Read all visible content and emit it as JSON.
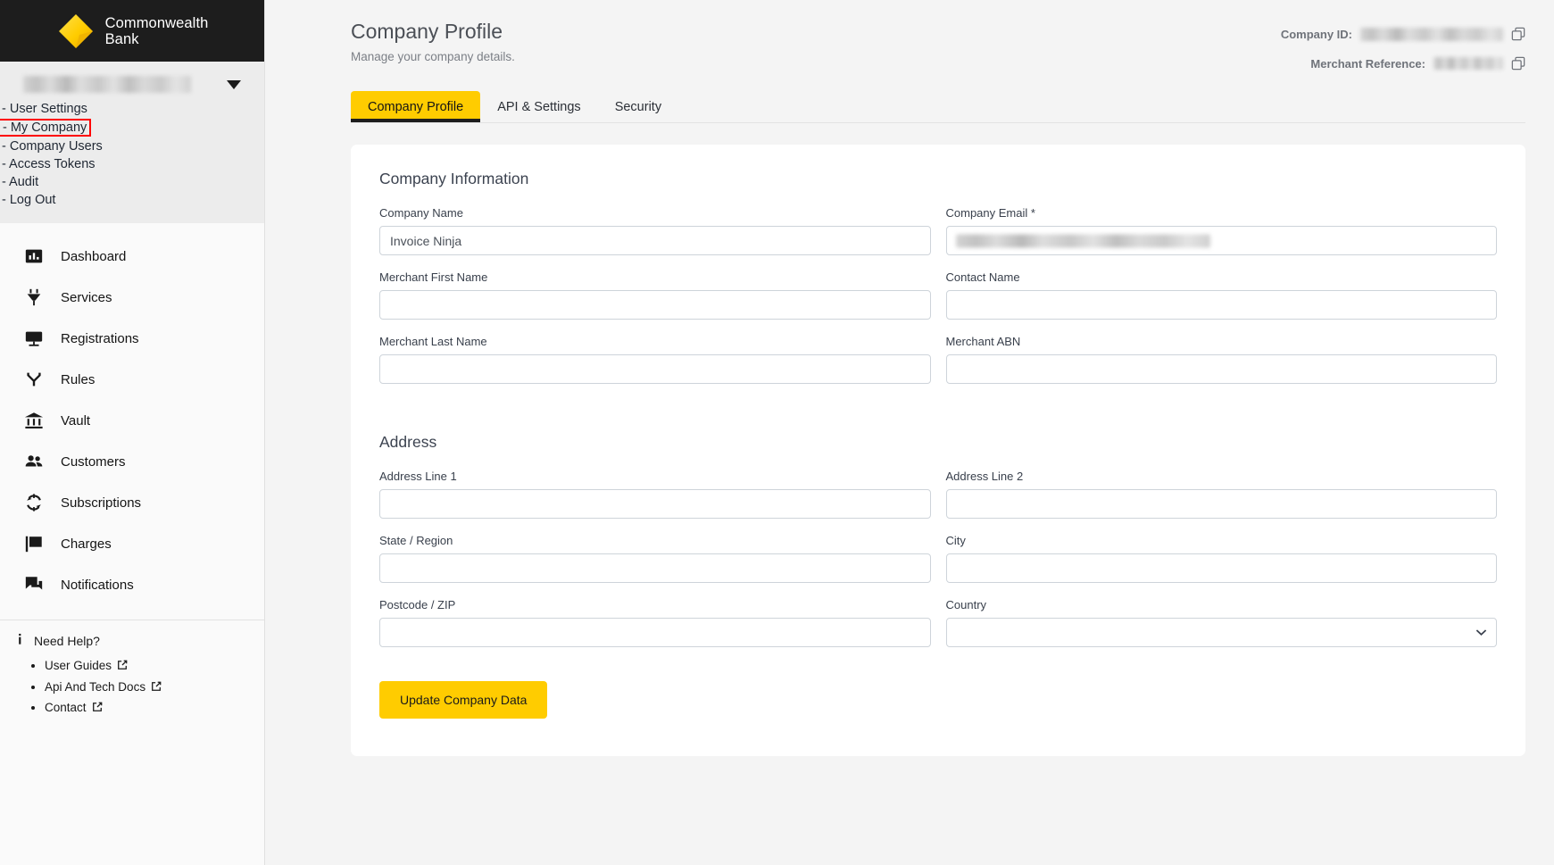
{
  "brand": {
    "logo_name": "commonwealth-bank-logo",
    "logo_line1": "Commonwealth",
    "logo_line2": "Bank",
    "accent_yellow": "#ffcc00",
    "logo_dark": "#1d1d1d",
    "highlight_red": "#ff0000"
  },
  "sidebar": {
    "account_menu": {
      "username_redacted": true,
      "items": [
        {
          "label": "- User Settings",
          "highlighted": false
        },
        {
          "label": "- My Company",
          "highlighted": true
        },
        {
          "label": "- Company Users",
          "highlighted": false
        },
        {
          "label": "- Access Tokens",
          "highlighted": false
        },
        {
          "label": "- Audit",
          "highlighted": false
        },
        {
          "label": "- Log Out",
          "highlighted": false
        }
      ]
    },
    "nav": [
      {
        "label": "Dashboard",
        "icon": "chart-bar-icon"
      },
      {
        "label": "Services",
        "icon": "plug-icon"
      },
      {
        "label": "Registrations",
        "icon": "monitor-icon"
      },
      {
        "label": "Rules",
        "icon": "branch-icon"
      },
      {
        "label": "Vault",
        "icon": "bank-icon"
      },
      {
        "label": "Customers",
        "icon": "people-icon"
      },
      {
        "label": "Subscriptions",
        "icon": "refresh-icon"
      },
      {
        "label": "Charges",
        "icon": "flag-icon"
      },
      {
        "label": "Notifications",
        "icon": "chat-icon"
      }
    ],
    "help": {
      "title": "Need Help?",
      "icon": "info-icon",
      "links": [
        {
          "label": "User Guides",
          "icon": "external-link-icon"
        },
        {
          "label": "Api And Tech Docs",
          "icon": "external-link-icon"
        },
        {
          "label": "Contact",
          "icon": "external-link-icon"
        }
      ]
    }
  },
  "header": {
    "title": "Company Profile",
    "subtitle": "Manage your company details.",
    "company_id_label": "Company ID:",
    "company_id_value": "",
    "merchant_reference_label": "Merchant Reference:",
    "merchant_reference_value": "",
    "copy_icon": "copy-icon"
  },
  "tabs": [
    {
      "label": "Company Profile",
      "active": true
    },
    {
      "label": "API & Settings",
      "active": false
    },
    {
      "label": "Security",
      "active": false
    }
  ],
  "form": {
    "company_section_title": "Company Information",
    "address_section_title": "Address",
    "fields": {
      "company_name": {
        "label": "Company Name",
        "value": "Invoice Ninja"
      },
      "company_email": {
        "label": "Company Email *",
        "value": ""
      },
      "merchant_first_name": {
        "label": "Merchant First Name",
        "value": ""
      },
      "contact_name": {
        "label": "Contact Name",
        "value": ""
      },
      "merchant_last_name": {
        "label": "Merchant Last Name",
        "value": ""
      },
      "merchant_abn": {
        "label": "Merchant ABN",
        "value": ""
      },
      "address_line_1": {
        "label": "Address Line 1",
        "value": ""
      },
      "address_line_2": {
        "label": "Address Line 2",
        "value": ""
      },
      "state_region": {
        "label": "State / Region",
        "value": ""
      },
      "city": {
        "label": "City",
        "value": ""
      },
      "postcode_zip": {
        "label": "Postcode / ZIP",
        "value": ""
      },
      "country": {
        "label": "Country",
        "value": "",
        "icon": "chevron-down-icon"
      }
    },
    "submit_label": "Update Company Data"
  }
}
